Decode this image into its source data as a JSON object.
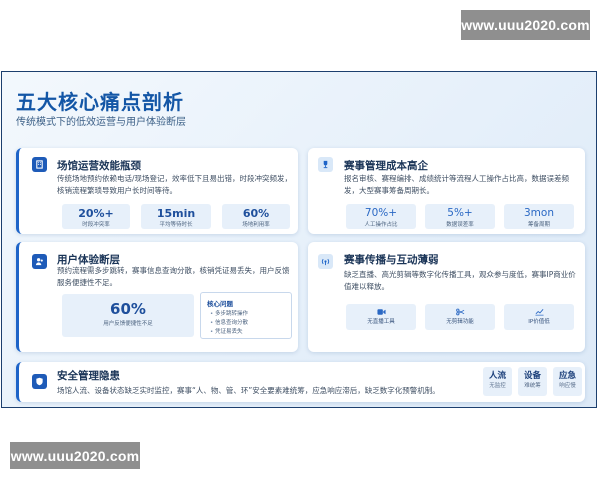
{
  "watermarks": {
    "top": "www.uuu2020.com",
    "bottom": "www.uuu2020.com"
  },
  "slide": {
    "title": "五大核心痛点剖析",
    "subtitle": "传统模式下的低效运营与用户体验断层"
  },
  "cards": {
    "venue": {
      "icon": "building-icon",
      "title": "场馆运营效能瓶颈",
      "desc": "传统场地预约依赖电话/现场登记，效率低下且易出错，时段冲突频发，核销流程繁琐导致用户长时间等待。",
      "stats": [
        {
          "value": "20%+",
          "label": "时段冲突率"
        },
        {
          "value": "15min",
          "label": "平均等待时长"
        },
        {
          "value": "60%",
          "label": "场地利用率"
        }
      ]
    },
    "cost": {
      "icon": "trophy-icon",
      "title": "赛事管理成本高企",
      "desc": "报名审核、赛程编排、成绩统计等流程人工操作占比高，数据误差频发，大型赛事筹备周期长。",
      "stats": [
        {
          "value": "70%+",
          "label": "人工操作占比"
        },
        {
          "value": "5%+",
          "label": "数据误差率"
        },
        {
          "value": "3mon",
          "label": "筹备周期"
        }
      ]
    },
    "user": {
      "icon": "user-icon",
      "title": "用户体验断层",
      "desc": "预约流程需多步跳转，赛事信息查询分散，核销凭证易丢失，用户反馈服务便捷性不足。",
      "percent": {
        "value": "60%",
        "label": "用户反馈便捷性不足"
      },
      "issues": {
        "title": "核心问题",
        "items": [
          "多步跳转操作",
          "信息查询分散",
          "凭证易丢失"
        ]
      }
    },
    "broadcast": {
      "icon": "broadcast-icon",
      "title": "赛事传播与互动薄弱",
      "desc": "缺乏直播、高光剪辑等数字化传播工具，观众参与度低，赛事IP商业价值难以释放。",
      "tools": [
        {
          "icon": "video-icon",
          "label": "无直播工具"
        },
        {
          "icon": "scissors-icon",
          "label": "无剪辑功能"
        },
        {
          "icon": "trend-icon",
          "label": "IP价值低"
        }
      ]
    },
    "security": {
      "icon": "shield-icon",
      "title": "安全管理隐患",
      "desc": "场馆人流、设备状态缺乏实时监控，赛事“人、物、管、环”安全要素难统筹，应急响应滞后，缺乏数字化预警机制。",
      "tags": [
        {
          "main": "人流",
          "sub": "无监控"
        },
        {
          "main": "设备",
          "sub": "难统筹"
        },
        {
          "main": "应急",
          "sub": "响应慢"
        }
      ]
    }
  },
  "colors": {
    "accent": "#1e64c8",
    "title": "#1356a6",
    "border": "#1c3f6e"
  }
}
